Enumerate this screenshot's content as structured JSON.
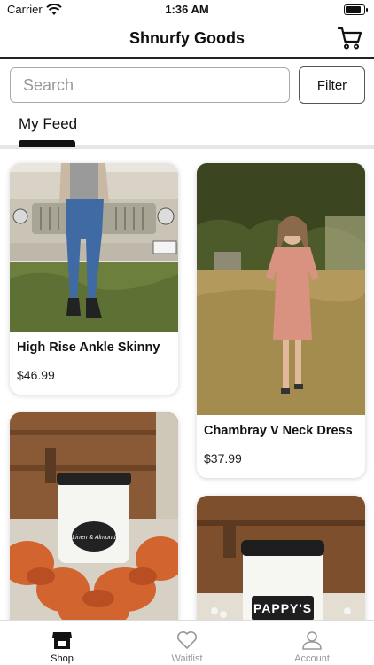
{
  "status_bar": {
    "carrier": "Carrier",
    "time": "1:36 AM"
  },
  "header": {
    "title": "Shnurfy Goods",
    "cart_icon": "cart-icon"
  },
  "search": {
    "placeholder": "Search",
    "value": ""
  },
  "filter": {
    "label": "Filter"
  },
  "feed_tabs": {
    "active": "My Feed"
  },
  "products": [
    {
      "title": "High Rise Ankle Skinny",
      "price": "$46.99"
    },
    {
      "title": "Chambray V Neck Dress",
      "price": "$37.99"
    },
    {
      "title": "",
      "price": "",
      "image_text": "Linen & Almond"
    },
    {
      "title": "",
      "price": "",
      "image_text": "PAPPY'S"
    }
  ],
  "bottom_tabs": [
    {
      "label": "Shop",
      "icon": "store-icon",
      "active": true
    },
    {
      "label": "Waitlist",
      "icon": "heart-icon",
      "active": false
    },
    {
      "label": "Account",
      "icon": "person-icon",
      "active": false
    }
  ],
  "colors": {
    "accent": "#111111",
    "inactive": "#999999"
  }
}
